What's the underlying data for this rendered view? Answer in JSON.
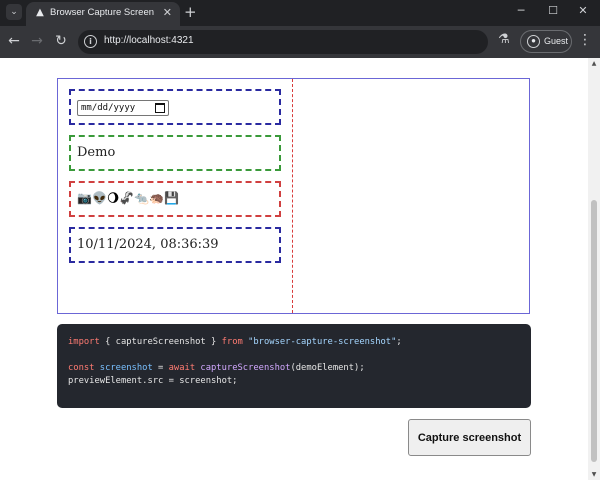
{
  "browser": {
    "tab_title": "Browser Capture Screen",
    "url": "http://localhost:4321",
    "guest_label": "Guest"
  },
  "demo": {
    "date_placeholder": "mm/dd/yyyy",
    "text_value": "Demo",
    "emoji": "📷👽🌖🦨🐀🦔💾",
    "timestamp": "10/11/2024, 08:36:39"
  },
  "code": {
    "line1": {
      "kw1": "import",
      "p1": " { ",
      "fn": "captureScreenshot",
      "p2": " } ",
      "kw2": "from",
      "p3": " ",
      "str": "\"browser-capture-screenshot\"",
      "p4": ";"
    },
    "line3": {
      "kw1": "const",
      "p1": " ",
      "var": "screenshot",
      "p2": " = ",
      "kw2": "await",
      "p3": " ",
      "fn": "captureScreenshot",
      "p4": "(demoElement);"
    },
    "line4": "previewElement.src = screenshot;"
  },
  "capture_button_label": "Capture screenshot",
  "colors": {
    "outer_border": "#6b66d6",
    "inner_divider": "#d83b3b",
    "code_bg": "#24272e"
  }
}
